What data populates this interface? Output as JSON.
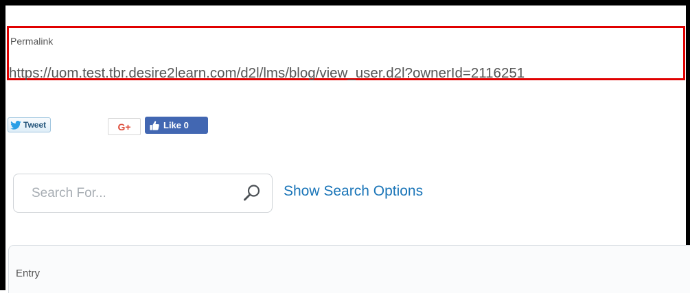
{
  "permalink": {
    "label": "Permalink",
    "url": "https://uom.test.tbr.desire2learn.com/d2l/lms/blog/view_user.d2l?ownerId=2116251"
  },
  "share": {
    "tweet_label": "Tweet",
    "gplus_label": "G+",
    "like_label": "Like 0",
    "icons": [
      "twitter-bird-icon",
      "thumbs-up-icon"
    ]
  },
  "search": {
    "placeholder": "Search For...",
    "value": "",
    "options_link": "Show Search Options",
    "icon": "search-icon"
  },
  "entry": {
    "label": "Entry"
  },
  "colors": {
    "highlight_border": "#e00000",
    "link": "#1a75b8",
    "facebook": "#4267b2",
    "gplus": "#dd4b39",
    "twitter_blue": "#2b9fe6"
  }
}
